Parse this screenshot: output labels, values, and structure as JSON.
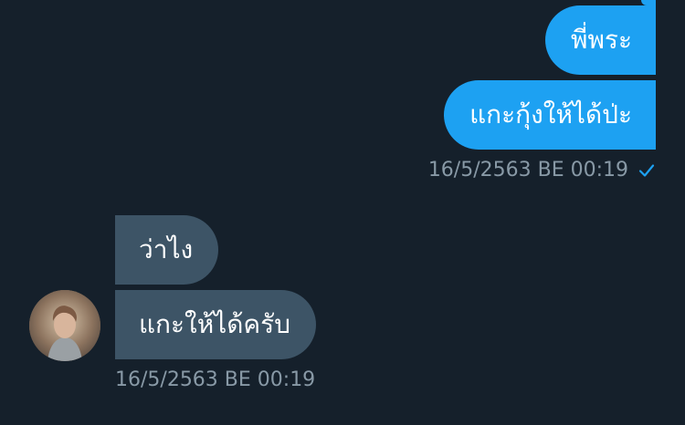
{
  "conversation": {
    "outgoing": {
      "messages": [
        "พี่พระ",
        "แกะกุ้งให้ได้ป่ะ"
      ],
      "timestamp": "16/5/2563 BE 00:19",
      "read_icon": "check-icon"
    },
    "incoming": {
      "messages": [
        "ว่าไง",
        "แกะให้ได้ครับ"
      ],
      "timestamp": "16/5/2563 BE 00:19",
      "avatar_icon": "avatar"
    }
  },
  "colors": {
    "background": "#15202b",
    "sent_bubble": "#1da1f2",
    "received_bubble": "#3d5466",
    "timestamp": "#8899a6",
    "check": "#1da1f2"
  }
}
